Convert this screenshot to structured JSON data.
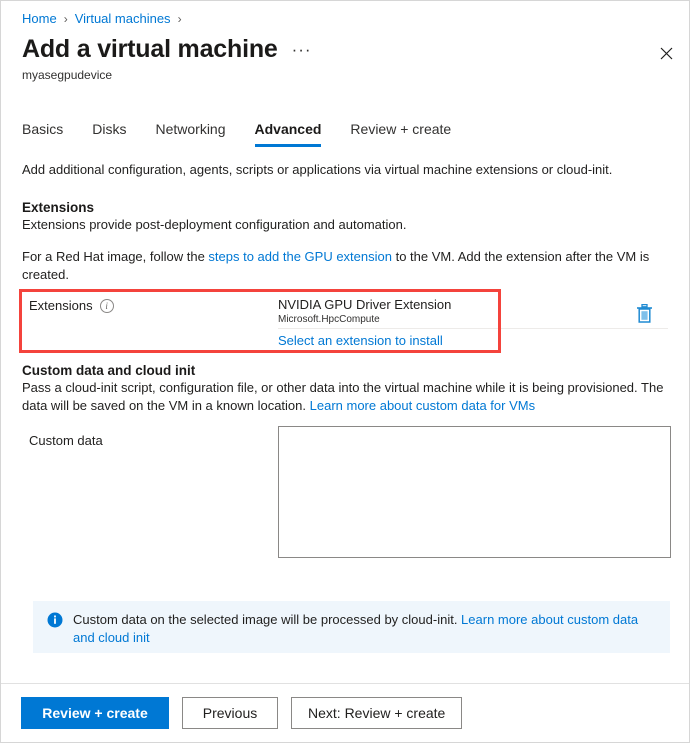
{
  "breadcrumb": {
    "items": [
      {
        "label": "Home"
      },
      {
        "label": "Virtual machines"
      }
    ],
    "separator": "›",
    "trailing_separator": "›"
  },
  "header": {
    "title": "Add a virtual machine",
    "ellipsis": "···",
    "subtitle": "myasegpudevice",
    "close_icon": "close-icon",
    "close_glyph": "✕"
  },
  "tabs": [
    {
      "label": "Basics",
      "active": false
    },
    {
      "label": "Disks",
      "active": false
    },
    {
      "label": "Networking",
      "active": false
    },
    {
      "label": "Advanced",
      "active": true
    },
    {
      "label": "Review + create",
      "active": false
    }
  ],
  "main": {
    "intro": "Add additional configuration, agents, scripts or applications via virtual machine extensions or cloud-init.",
    "extensions_section": {
      "heading": "Extensions",
      "description": "Extensions provide post-deployment configuration and automation.",
      "redhat_note_before": "For a Red Hat image, follow the ",
      "redhat_note_link": "steps to add the GPU extension",
      "redhat_note_after": " to the VM. Add the extension after the VM is created.",
      "field_label": "Extensions",
      "info_icon": "info-icon",
      "info_glyph": "i",
      "extension_name": "NVIDIA GPU Driver Extension",
      "extension_publisher": "Microsoft.HpcCompute",
      "select_extension_link": "Select an extension to install",
      "delete_icon": "trash-icon",
      "highlight_color": "#f4433c"
    },
    "custom_data_section": {
      "heading": "Custom data and cloud init",
      "description_line1": "Pass a cloud-init script, configuration file, or other data into the virtual machine while it is being provisioned.",
      "description_line2_before": "The data will be saved on the VM in a known location. ",
      "description_line2_link": "Learn more about custom data for VMs",
      "field_label": "Custom data",
      "textarea_value": "",
      "textarea_placeholder": ""
    },
    "info_banner": {
      "icon": "info-filled-icon",
      "text_before": "Custom data on the selected image will be processed by cloud-init. ",
      "link": "Learn more about custom data and cloud init",
      "background": "#eff6fc"
    }
  },
  "footer": {
    "review_create_label": "Review + create",
    "previous_label": "Previous",
    "next_label": "Next: Review + create"
  },
  "colors": {
    "accent": "#0078d4",
    "link": "#0078d4",
    "highlight": "#f4433c",
    "text": "#201f1e"
  }
}
